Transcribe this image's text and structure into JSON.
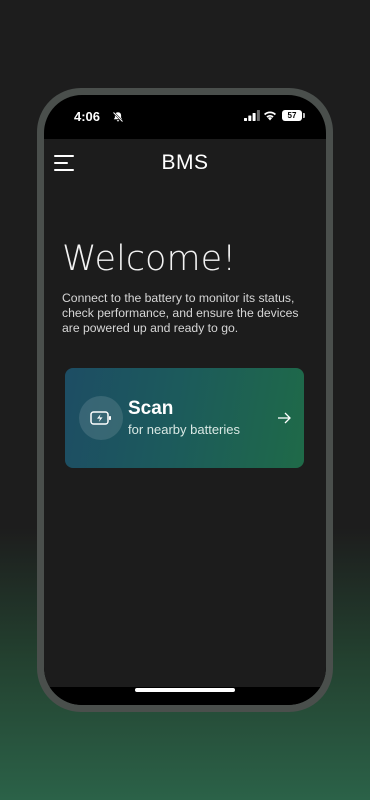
{
  "status_bar": {
    "time": "4:06",
    "battery_level": "57",
    "icons": [
      "bell-slash-icon",
      "signal-icon",
      "wifi-icon",
      "battery-icon"
    ]
  },
  "header": {
    "menu_icon": "hamburger-menu-icon",
    "title": "BMS"
  },
  "main": {
    "welcome_title": "Welcome!",
    "welcome_description": "Connect to the battery to monitor its status, check performance, and ensure the devices are powered up and ready to go."
  },
  "scan_card": {
    "icon": "battery-charging-icon",
    "title": "Scan",
    "subtitle": "for nearby batteries",
    "arrow_icon": "arrow-right-icon"
  },
  "colors": {
    "background_top": "#1d1d1d",
    "background_bottom": "#2b6248",
    "app_background": "#1c1c1c",
    "card_gradient_start": "#1d4d64",
    "card_gradient_end": "#1f6a48",
    "phone_frame": "#4a4f4c"
  }
}
